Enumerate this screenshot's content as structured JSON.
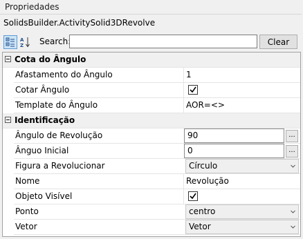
{
  "panel": {
    "title": "Propriedades",
    "object_name": "SolidsBuilder.ActivitySolid3DRevolve"
  },
  "toolbar": {
    "categorized_icon": "categorized-icon",
    "alphabetical_icon": "alphabetical-sort-icon",
    "search_label": "Search:",
    "search_value": "",
    "search_placeholder": "",
    "clear_label": "Clear"
  },
  "categories": [
    {
      "label": "Cota do Ângulo",
      "rows": [
        {
          "name": "Afastamento do Ângulo",
          "value": "1",
          "editor": "text"
        },
        {
          "name": "Cotar Ângulo",
          "value": "true",
          "editor": "checkbox"
        },
        {
          "name": "Template do Ângulo",
          "value": "AOR=<>",
          "editor": "text"
        }
      ]
    },
    {
      "label": "Identificação",
      "rows": [
        {
          "name": "Ângulo de Revolução",
          "value": "90",
          "editor": "ellipsis"
        },
        {
          "name": "Ânguo Inicial",
          "value": "0",
          "editor": "ellipsis"
        },
        {
          "name": "Figura a Revolucionar",
          "value": "Círculo",
          "editor": "dropdown"
        },
        {
          "name": "Nome",
          "value": "Revolução",
          "editor": "text"
        },
        {
          "name": "Objeto Visível",
          "value": "true",
          "editor": "checkbox"
        },
        {
          "name": "Ponto",
          "value": "centro",
          "editor": "dropdown"
        },
        {
          "name": "Vetor",
          "value": "Vetor",
          "editor": "dropdown"
        }
      ]
    }
  ]
}
